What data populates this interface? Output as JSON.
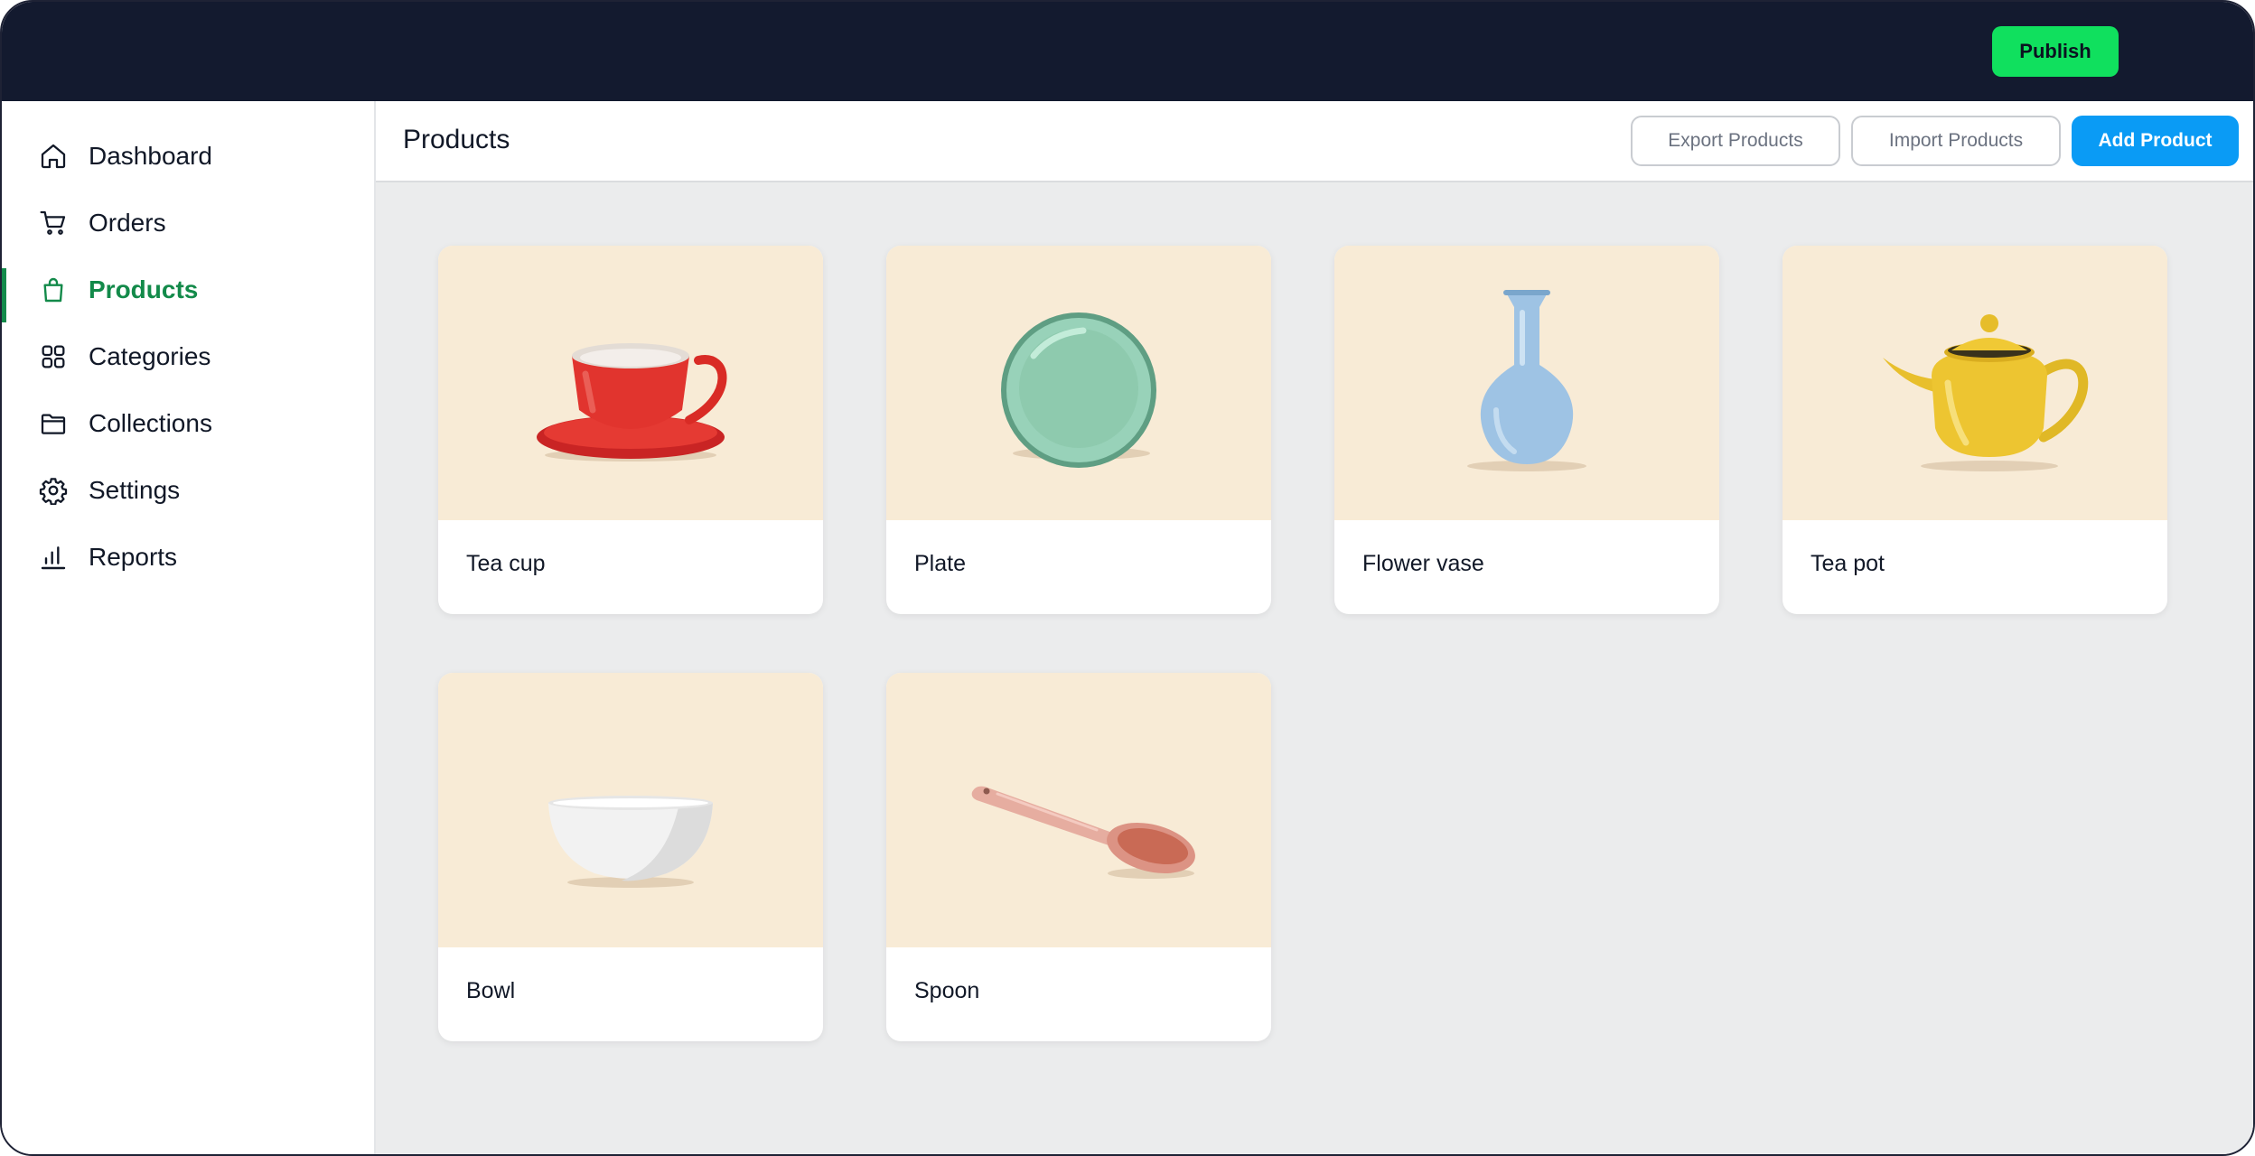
{
  "topbar": {
    "publish_label": "Publish"
  },
  "sidebar": {
    "items": [
      {
        "label": "Dashboard",
        "icon": "home-icon",
        "active": false
      },
      {
        "label": "Orders",
        "icon": "cart-icon",
        "active": false
      },
      {
        "label": "Products",
        "icon": "shopping-bag-icon",
        "active": true
      },
      {
        "label": "Categories",
        "icon": "grid-icon",
        "active": false
      },
      {
        "label": "Collections",
        "icon": "folder-icon",
        "active": false
      },
      {
        "label": "Settings",
        "icon": "gear-icon",
        "active": false
      },
      {
        "label": "Reports",
        "icon": "bar-chart-icon",
        "active": false
      }
    ]
  },
  "header": {
    "title": "Products",
    "export_label": "Export Products",
    "import_label": "Import Products",
    "add_label": "Add Product"
  },
  "products": [
    {
      "name": "Tea cup",
      "image": "tea-cup-image"
    },
    {
      "name": "Plate",
      "image": "plate-image"
    },
    {
      "name": "Flower vase",
      "image": "flower-vase-image"
    },
    {
      "name": "Tea pot",
      "image": "tea-pot-image"
    },
    {
      "name": "Bowl",
      "image": "bowl-image"
    },
    {
      "name": "Spoon",
      "image": "spoon-image"
    }
  ],
  "colors": {
    "topbar": "#131a2f",
    "publish": "#10e05e",
    "accent_green": "#138a4a",
    "primary_blue": "#0a9bf5",
    "card_image_bg": "#f8ebd6",
    "canvas": "#ebeced"
  }
}
